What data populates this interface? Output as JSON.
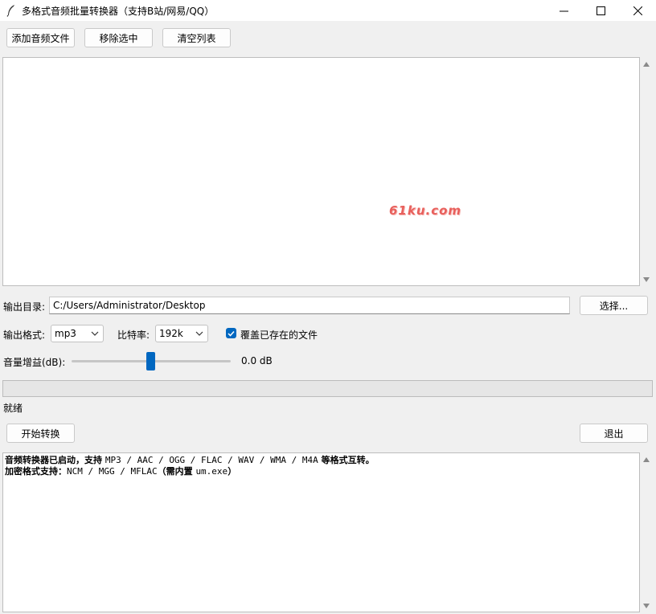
{
  "window": {
    "title": "多格式音频批量转换器（支持B站/网易/QQ）"
  },
  "toolbar": {
    "add_label": "添加音频文件",
    "remove_label": "移除选中",
    "clear_label": "清空列表"
  },
  "watermark": "61ku.com",
  "output": {
    "dir_label": "输出目录:",
    "dir_value": "C:/Users/Administrator/Desktop",
    "browse_label": "选择..."
  },
  "format": {
    "format_label": "输出格式:",
    "format_value": "mp3",
    "bitrate_label": "比特率:",
    "bitrate_value": "192k",
    "overwrite_label": "覆盖已存在的文件",
    "overwrite_checked": true
  },
  "gain": {
    "label": "音量增益(dB):",
    "value_text": "0.0 dB"
  },
  "progress": {
    "percent": 0
  },
  "status": {
    "text": "就绪"
  },
  "actions": {
    "start_label": "开始转换",
    "exit_label": "退出"
  },
  "log": {
    "line1_prefix": "音频转换器已启动，支持 ",
    "line1_formats": "MP3 / AAC / OGG / FLAC / WAV / WMA / M4A",
    "line1_suffix": " 等格式互转。",
    "line2_prefix": "加密格式支持：",
    "line2_formats": "NCM / MGG / MFLAC",
    "line2_mid": "（需内置 ",
    "line2_tool": "um.exe",
    "line2_end": "）"
  },
  "colors": {
    "accent": "#0067c0",
    "watermark": "#e8605c"
  }
}
